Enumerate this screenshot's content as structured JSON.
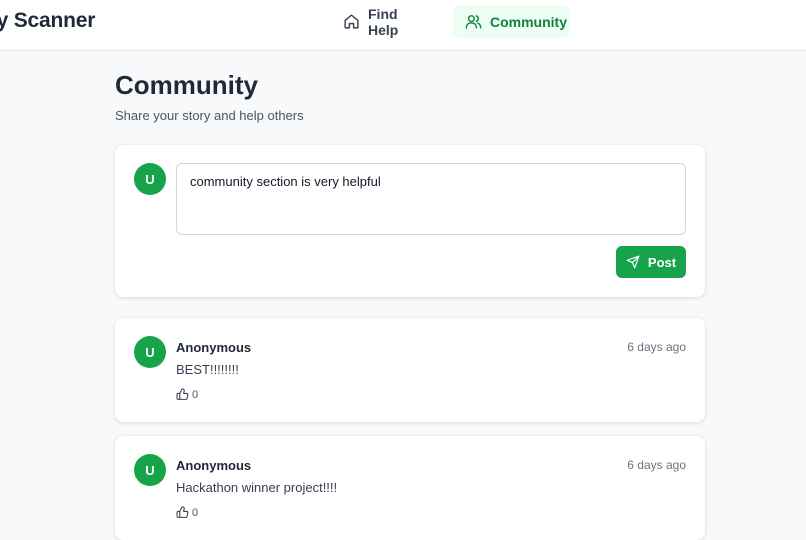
{
  "header": {
    "brand": "dy Scanner",
    "nav": [
      {
        "label": "Find Help",
        "icon": "home-icon",
        "active": false
      },
      {
        "label": "Community",
        "icon": "users-icon",
        "active": true
      }
    ]
  },
  "page": {
    "title": "Community",
    "subtitle": "Share your story and help others"
  },
  "composer": {
    "avatar_initial": "U",
    "input_value": "community section is very helpful",
    "post_label": "Post"
  },
  "posts": [
    {
      "avatar_initial": "U",
      "author": "Anonymous",
      "time": "6 days ago",
      "content": "BEST!!!!!!!!",
      "likes": "0"
    },
    {
      "avatar_initial": "U",
      "author": "Anonymous",
      "time": "6 days ago",
      "content": "Hackathon winner project!!!!",
      "likes": "0"
    }
  ],
  "colors": {
    "accent": "#16a34a",
    "accent_light": "#ecfdf3",
    "accent_text": "#15803d"
  }
}
